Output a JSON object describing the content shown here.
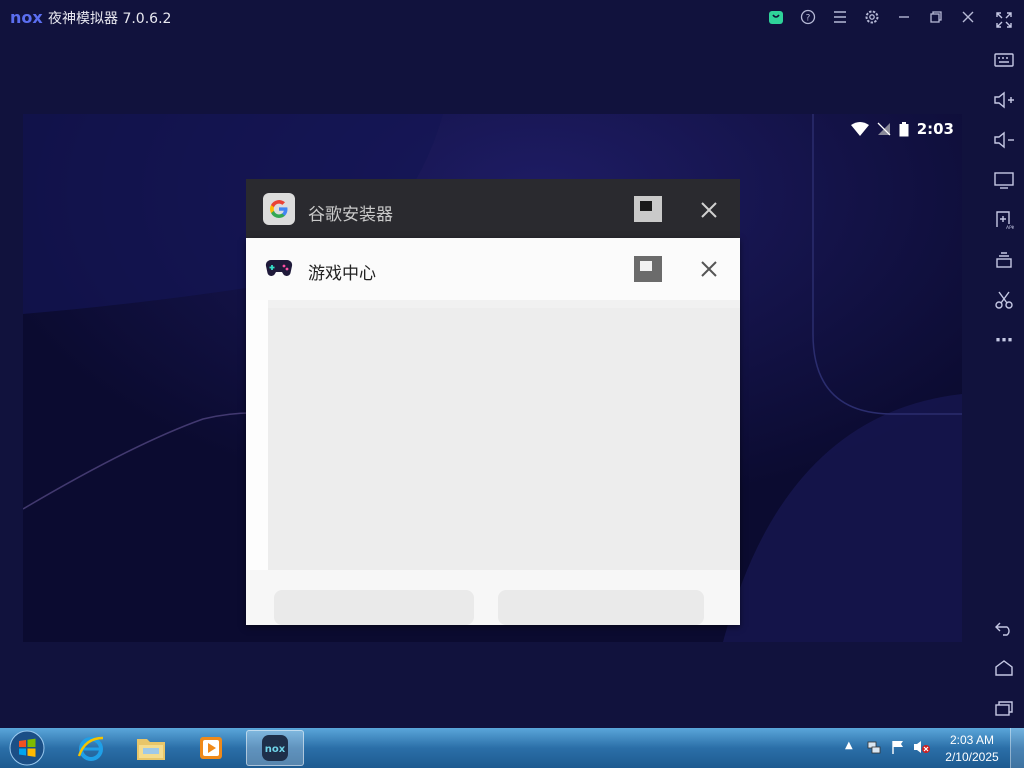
{
  "app": {
    "logo": "nox",
    "title": "夜神模拟器 7.0.6.2"
  },
  "titlebar_icons": [
    "store-icon",
    "help-icon",
    "menu-icon",
    "settings-icon",
    "minimize-icon",
    "restore-icon",
    "close-icon",
    "fullscreen-icon"
  ],
  "sidebar_icons": [
    "keyboard-icon",
    "volume-up-icon",
    "volume-down-icon",
    "screen-icon",
    "install-apk-icon",
    "multi-instance-icon",
    "scissors-icon",
    "more-icon",
    "back-icon",
    "home-icon",
    "recents-icon"
  ],
  "sidebar_more": "⋯",
  "android": {
    "time": "2:03"
  },
  "recents": [
    {
      "title": "谷歌安装器",
      "icon": "google-g-icon"
    },
    {
      "title": "游戏中心",
      "icon": "gamepad-icon"
    }
  ],
  "colors": {
    "accent": "#5b6ef0",
    "background": "#11123d",
    "store_green": "#2fd39a"
  },
  "taskbar": {
    "items": [
      "start-orb-icon",
      "internet-explorer-icon",
      "file-explorer-icon",
      "media-player-icon",
      "nox-taskbar-icon"
    ],
    "time": "2:03 AM",
    "date": "2/10/2025"
  }
}
